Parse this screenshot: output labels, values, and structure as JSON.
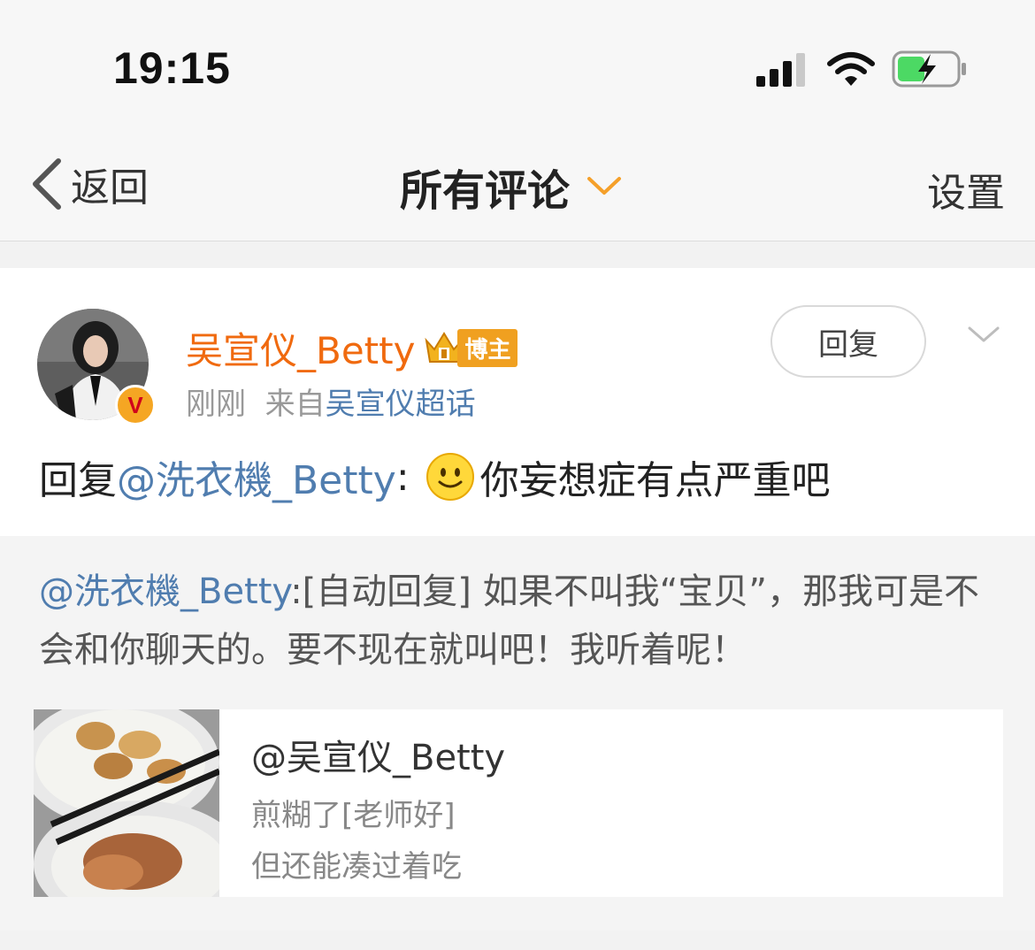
{
  "status_bar": {
    "time": "19:15"
  },
  "nav": {
    "back_label": "返回",
    "title": "所有评论",
    "settings_label": "设置"
  },
  "comment": {
    "username": "吴宣仪_Betty",
    "badge_label": "博主",
    "verified_mark": "V",
    "time": "刚刚",
    "source_prefix": "来自",
    "source_name": "吴宣仪超话",
    "reply_button": "回复",
    "reply_prefix": "回复",
    "reply_to": "@洗衣機_Betty",
    "colon": ":",
    "text": "你妄想症有点严重吧"
  },
  "quoted": {
    "mention": "@洗衣機_Betty",
    "text": ":[自动回复] 如果不叫我“宝贝”，那我可是不会和你聊天的。要不现在就叫吧！我听着呢！"
  },
  "original_post": {
    "author": "@吴宣仪_Betty",
    "line1": "煎糊了[老师好]",
    "line2": "但还能凑过着吃"
  },
  "colors": {
    "accent_orange": "#f06a0f",
    "link_blue": "#507daf",
    "badge_gold": "#f0a020"
  },
  "icons": [
    "signal-icon",
    "wifi-icon",
    "battery-charging-icon",
    "back-chevron-icon",
    "dropdown-chevron-icon",
    "more-chevron-icon",
    "verified-v-icon",
    "crown-icon",
    "smile-emoji-icon"
  ]
}
